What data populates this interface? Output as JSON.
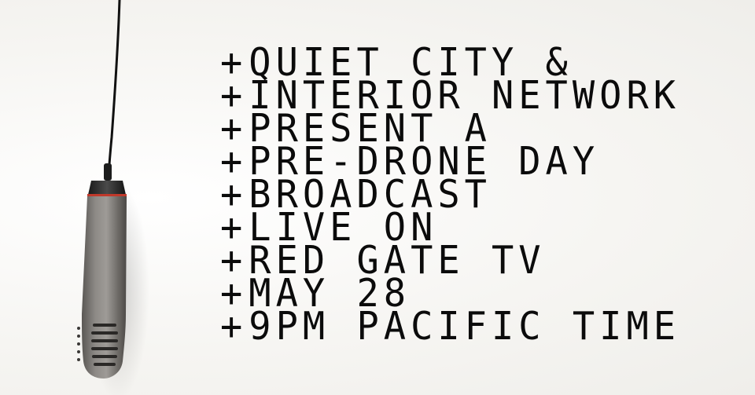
{
  "announcement": {
    "prefix": "+",
    "lines": [
      "QUIET CITY &",
      "INTERIOR NETWORK",
      "PRESENT A",
      "PRE-DRONE DAY",
      "BROADCAST",
      "LIVE ON",
      "RED GATE TV",
      "MAY 28",
      "9PM PACIFIC TIME"
    ]
  },
  "colors": {
    "background": "#f7f6f3",
    "text": "#0b0b0b",
    "microphone_body": "#6b6864",
    "microphone_ring": "#c0392b"
  },
  "icons": {
    "microphone": "microphone-icon"
  }
}
